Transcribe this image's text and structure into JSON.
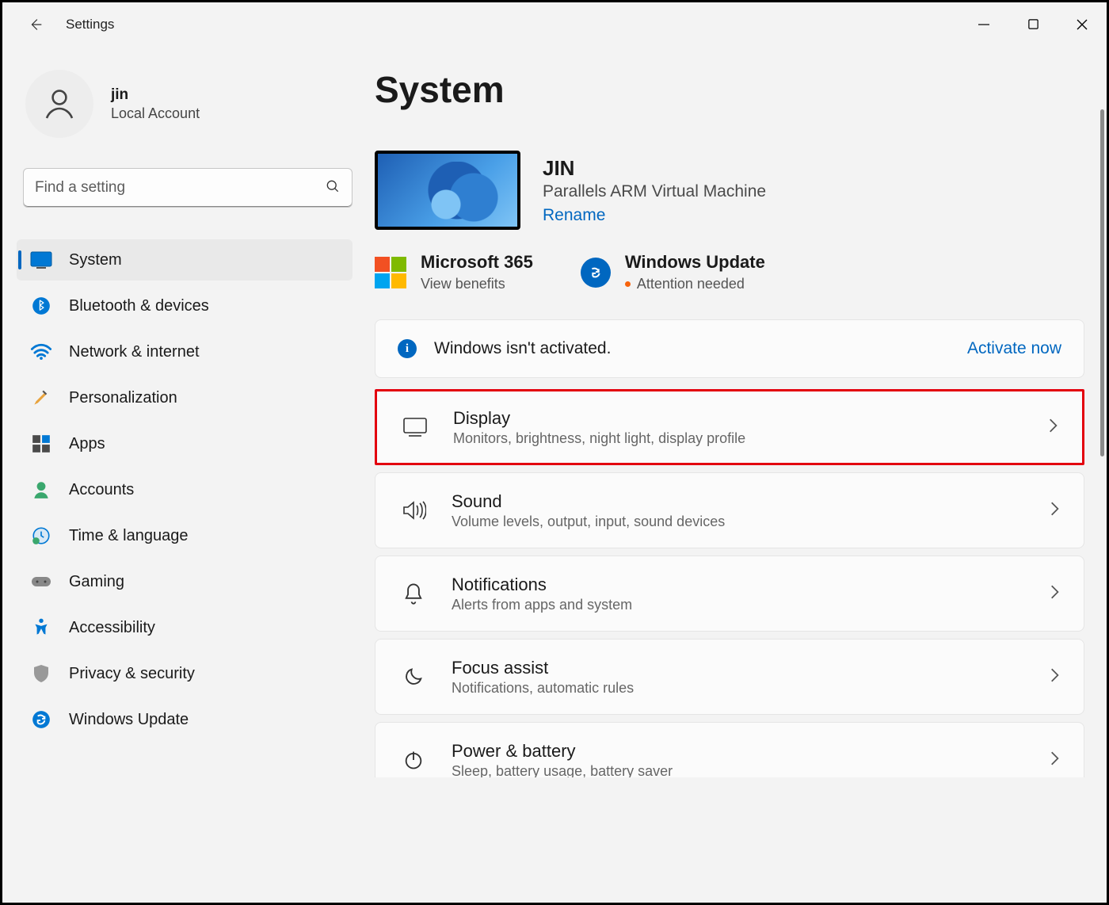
{
  "app_title": "Settings",
  "profile": {
    "name": "jin",
    "sub": "Local Account"
  },
  "search": {
    "placeholder": "Find a setting"
  },
  "nav": [
    {
      "label": "System",
      "selected": true
    },
    {
      "label": "Bluetooth & devices"
    },
    {
      "label": "Network & internet"
    },
    {
      "label": "Personalization"
    },
    {
      "label": "Apps"
    },
    {
      "label": "Accounts"
    },
    {
      "label": "Time & language"
    },
    {
      "label": "Gaming"
    },
    {
      "label": "Accessibility"
    },
    {
      "label": "Privacy & security"
    },
    {
      "label": "Windows Update"
    }
  ],
  "page_title": "System",
  "device": {
    "name": "JIN",
    "sub": "Parallels ARM Virtual Machine",
    "rename": "Rename"
  },
  "tiles": {
    "ms365": {
      "title": "Microsoft 365",
      "sub": "View benefits"
    },
    "wu": {
      "title": "Windows Update",
      "sub": "Attention needed"
    }
  },
  "banner": {
    "text": "Windows isn't activated.",
    "link": "Activate now"
  },
  "settings": [
    {
      "title": "Display",
      "sub": "Monitors, brightness, night light, display profile"
    },
    {
      "title": "Sound",
      "sub": "Volume levels, output, input, sound devices"
    },
    {
      "title": "Notifications",
      "sub": "Alerts from apps and system"
    },
    {
      "title": "Focus assist",
      "sub": "Notifications, automatic rules"
    },
    {
      "title": "Power & battery",
      "sub": "Sleep, battery usage, battery saver"
    }
  ]
}
